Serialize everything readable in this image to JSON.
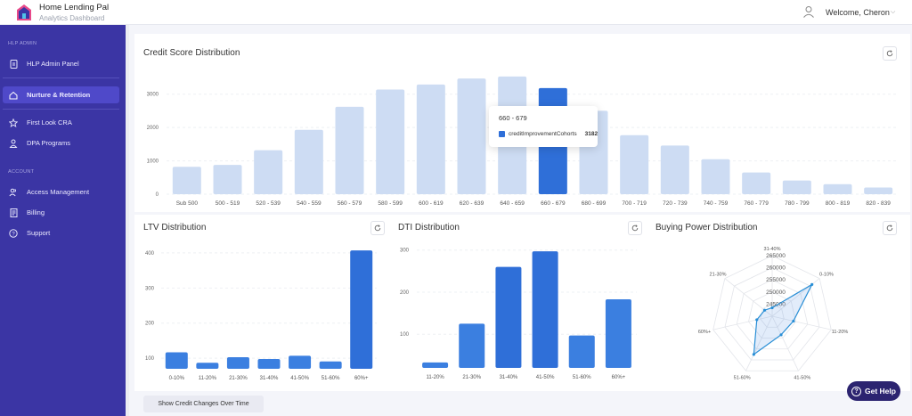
{
  "header": {
    "app_name": "Home Lending Pal",
    "subtitle": "Analytics Dashboard",
    "welcome": "Welcome, Cheron",
    "user_icon": "user-icon",
    "chevron_icon": "chevron-down-icon"
  },
  "sidebar": {
    "sections": [
      {
        "label": "HLP ADMIN"
      },
      {
        "label": "ACCOUNT"
      }
    ],
    "items": [
      {
        "label": "HLP Admin Panel",
        "icon": "document-icon",
        "active": false
      },
      {
        "label": "Nurture & Retention",
        "icon": "home-icon",
        "active": true
      },
      {
        "label": "First Look CRA",
        "icon": "star-icon",
        "active": false
      },
      {
        "label": "DPA Programs",
        "icon": "people-icon",
        "active": false
      },
      {
        "label": "Access Management",
        "icon": "users-icon",
        "active": false
      },
      {
        "label": "Billing",
        "icon": "receipt-icon",
        "active": false
      },
      {
        "label": "Support",
        "icon": "help-circle-icon",
        "active": false
      }
    ]
  },
  "credit_card": {
    "title": "Credit Score Distribution",
    "tooltip": {
      "title": "660 - 679",
      "series": "creditImprovementCohorts",
      "value": "3182"
    }
  },
  "ltv_card": {
    "title": "LTV Distribution"
  },
  "dti_card": {
    "title": "DTI Distribution"
  },
  "buying_card": {
    "title": "Buying Power Distribution"
  },
  "buttons": {
    "show_changes": "Show Credit Changes Over Time",
    "help": "Get Help"
  },
  "colors": {
    "sidebar": "#3b35a4",
    "active_item": "#4f49c9",
    "bar_light": "#cddcf3",
    "bar_dark": "#2f6fd8",
    "help_button": "#2c2470"
  },
  "chart_data": [
    {
      "type": "bar",
      "title": "Credit Score Distribution",
      "categories": [
        "Sub 500",
        "500 - 519",
        "520 - 539",
        "540 - 559",
        "560 - 579",
        "580 - 599",
        "600 - 619",
        "620 - 639",
        "640 - 659",
        "660 - 679",
        "680 - 699",
        "700 - 719",
        "720 - 739",
        "740 - 759",
        "760 - 779",
        "780 - 799",
        "800 - 819",
        "820 - 839"
      ],
      "series": [
        {
          "name": "creditImprovementCohorts",
          "values": [
            820,
            880,
            1320,
            1930,
            2620,
            3140,
            3290,
            3470,
            3530,
            3182,
            2500,
            1770,
            1460,
            1050,
            650,
            410,
            300,
            200
          ]
        }
      ],
      "highlighted": "660 - 679",
      "ylim": [
        0,
        3500
      ],
      "yticks": [
        0,
        1000,
        2000,
        3000
      ],
      "grid": true
    },
    {
      "type": "bar",
      "title": "LTV Distribution",
      "categories": [
        "0-10%",
        "11-20%",
        "21-30%",
        "31-40%",
        "41-50%",
        "51-60%",
        "60%+"
      ],
      "values": [
        117,
        87,
        103,
        98,
        107,
        91,
        407
      ],
      "ylim": [
        70,
        420
      ],
      "yticks": [
        100,
        200,
        300,
        400
      ],
      "grid": true
    },
    {
      "type": "bar",
      "title": "DTI Distribution",
      "categories": [
        "11-20%",
        "21-30%",
        "31-40%",
        "41-50%",
        "51-60%",
        "60%+"
      ],
      "values": [
        33,
        125,
        260,
        297,
        97,
        183
      ],
      "ylim": [
        20,
        310
      ],
      "yticks": [
        100,
        200,
        300
      ],
      "grid": true
    },
    {
      "type": "radar",
      "title": "Buying Power Distribution",
      "categories": [
        "31-40%",
        "0-10%",
        "11-20%",
        "41-50%",
        "51-60%",
        "60%+",
        "21-30%"
      ],
      "values": [
        243500,
        261000,
        249000,
        248500,
        257500,
        246500,
        244000
      ],
      "ticks": [
        245000,
        250000,
        255000,
        260000,
        265000
      ],
      "range": [
        240000,
        265000
      ]
    }
  ]
}
